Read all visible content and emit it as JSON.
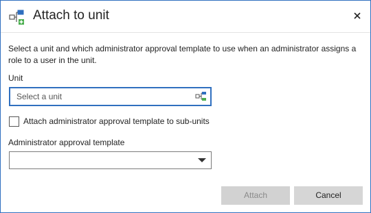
{
  "dialog": {
    "title": "Attach to unit",
    "description": "Select a unit and which administrator approval template to use when an administrator assigns a role to a user in the unit."
  },
  "unit": {
    "label": "Unit",
    "placeholder": "Select a unit",
    "value": ""
  },
  "checkbox": {
    "label": "Attach administrator approval template to sub-units",
    "checked": false
  },
  "template": {
    "label": "Administrator approval template",
    "selected": ""
  },
  "buttons": {
    "attach": "Attach",
    "cancel": "Cancel"
  },
  "colors": {
    "accent": "#2f6fbf",
    "icon_green": "#4caf50",
    "button_disabled_bg": "#d2d2d2",
    "button_bg": "#d6d6d6"
  },
  "icons": {
    "title": "org-unit-attach-icon",
    "close": "close-icon",
    "unit_picker": "org-unit-picker-icon",
    "dropdown": "chevron-down-icon"
  }
}
